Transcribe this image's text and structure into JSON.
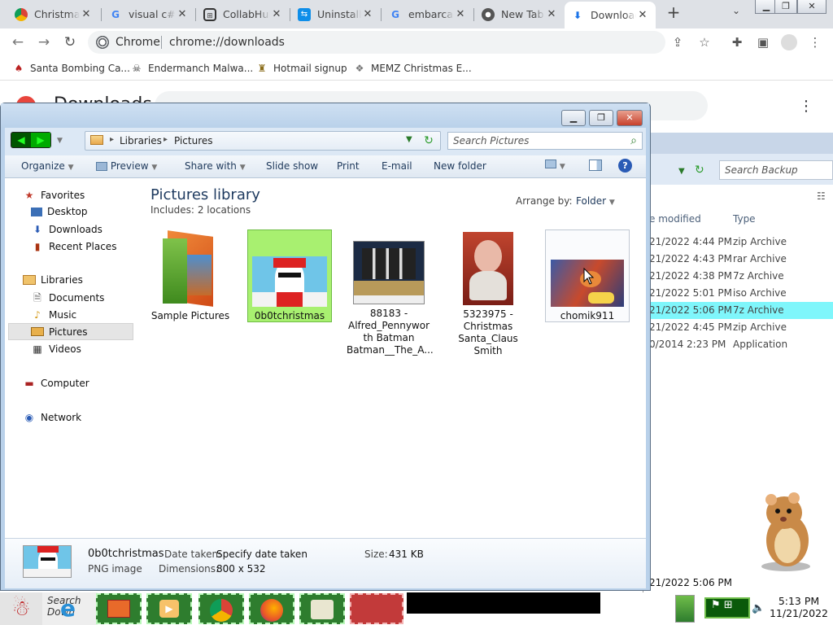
{
  "browser": {
    "tabs": [
      {
        "title": "Christmas",
        "icon": "chrome-icon"
      },
      {
        "title": "visual c#",
        "icon": "google-icon"
      },
      {
        "title": "CollabHub",
        "icon": "collab-icon"
      },
      {
        "title": "Uninstall",
        "icon": "teamviewer-icon"
      },
      {
        "title": "embarcadero",
        "icon": "google-icon"
      },
      {
        "title": "New Tab",
        "icon": "chrome-icon"
      },
      {
        "title": "Downloads",
        "icon": "download-icon"
      }
    ],
    "new_tab": "+",
    "omnibox_brand": "Chrome",
    "url": "chrome://downloads",
    "bookmarks": [
      {
        "label": "Santa Bombing Ca...",
        "icon": "santa-icon"
      },
      {
        "label": "Endermanch Malwa...",
        "icon": "skull-icon"
      },
      {
        "label": "Hotmail signup",
        "icon": "trophy-icon"
      },
      {
        "label": "MEMZ Christmas E...",
        "icon": "memz-icon"
      }
    ],
    "downloads_title": "Downloads"
  },
  "backup": {
    "search_placeholder": "Search Backup",
    "col_modified": "e modified",
    "col_type": "Type",
    "rows": [
      {
        "date": "21/2022 4:44 PM",
        "type": "zip Archive",
        "selected": false
      },
      {
        "date": "21/2022 4:43 PM",
        "type": "rar Archive",
        "selected": false
      },
      {
        "date": "21/2022 4:38 PM",
        "type": "7z Archive",
        "selected": false
      },
      {
        "date": "21/2022 5:01 PM",
        "type": "iso Archive",
        "selected": false
      },
      {
        "date": "21/2022 5:06 PM",
        "type": "7z Archive",
        "selected": true
      },
      {
        "date": "21/2022 4:45 PM",
        "type": "zip Archive",
        "selected": false
      },
      {
        "date": "0/2014 2:23 PM",
        "type": "Application",
        "selected": false
      }
    ],
    "footer_date": "21/2022 5:06 PM"
  },
  "explorer": {
    "breadcrumb": [
      "Libraries",
      "Pictures"
    ],
    "search_placeholder": "Search Pictures",
    "commands": [
      "Organize",
      "Preview",
      "Share with",
      "Slide show",
      "Print",
      "E-mail",
      "New folder"
    ],
    "nav": {
      "favorites": "Favorites",
      "desktop": "Desktop",
      "downloads": "Downloads",
      "recent": "Recent Places",
      "libraries": "Libraries",
      "documents": "Documents",
      "music": "Music",
      "pictures": "Pictures",
      "videos": "Videos",
      "computer": "Computer",
      "network": "Network"
    },
    "library_title": "Pictures library",
    "includes_label": "Includes:",
    "includes_value": "2 locations",
    "arrange_label": "Arrange by:",
    "arrange_value": "Folder",
    "files": [
      {
        "name": "Sample Pictures"
      },
      {
        "name": "0b0tchristmas"
      },
      {
        "name": "88183 - Alfred_Pennywor th Batman Batman__The_A..."
      },
      {
        "name": "5323975 - Christmas Santa_Claus Smith"
      },
      {
        "name": "chomik911"
      }
    ],
    "details": {
      "name": "0b0tchristmas",
      "kind": "PNG image",
      "date_label": "Date taken:",
      "date_value": "Specify date taken",
      "dim_label": "Dimensions:",
      "dim_value": "800 x 532",
      "size_label": "Size:",
      "size_value": "431 KB"
    }
  },
  "taskbar": {
    "search_placeholder": "Search Down",
    "time": "5:13 PM",
    "date": "11/21/2022"
  }
}
